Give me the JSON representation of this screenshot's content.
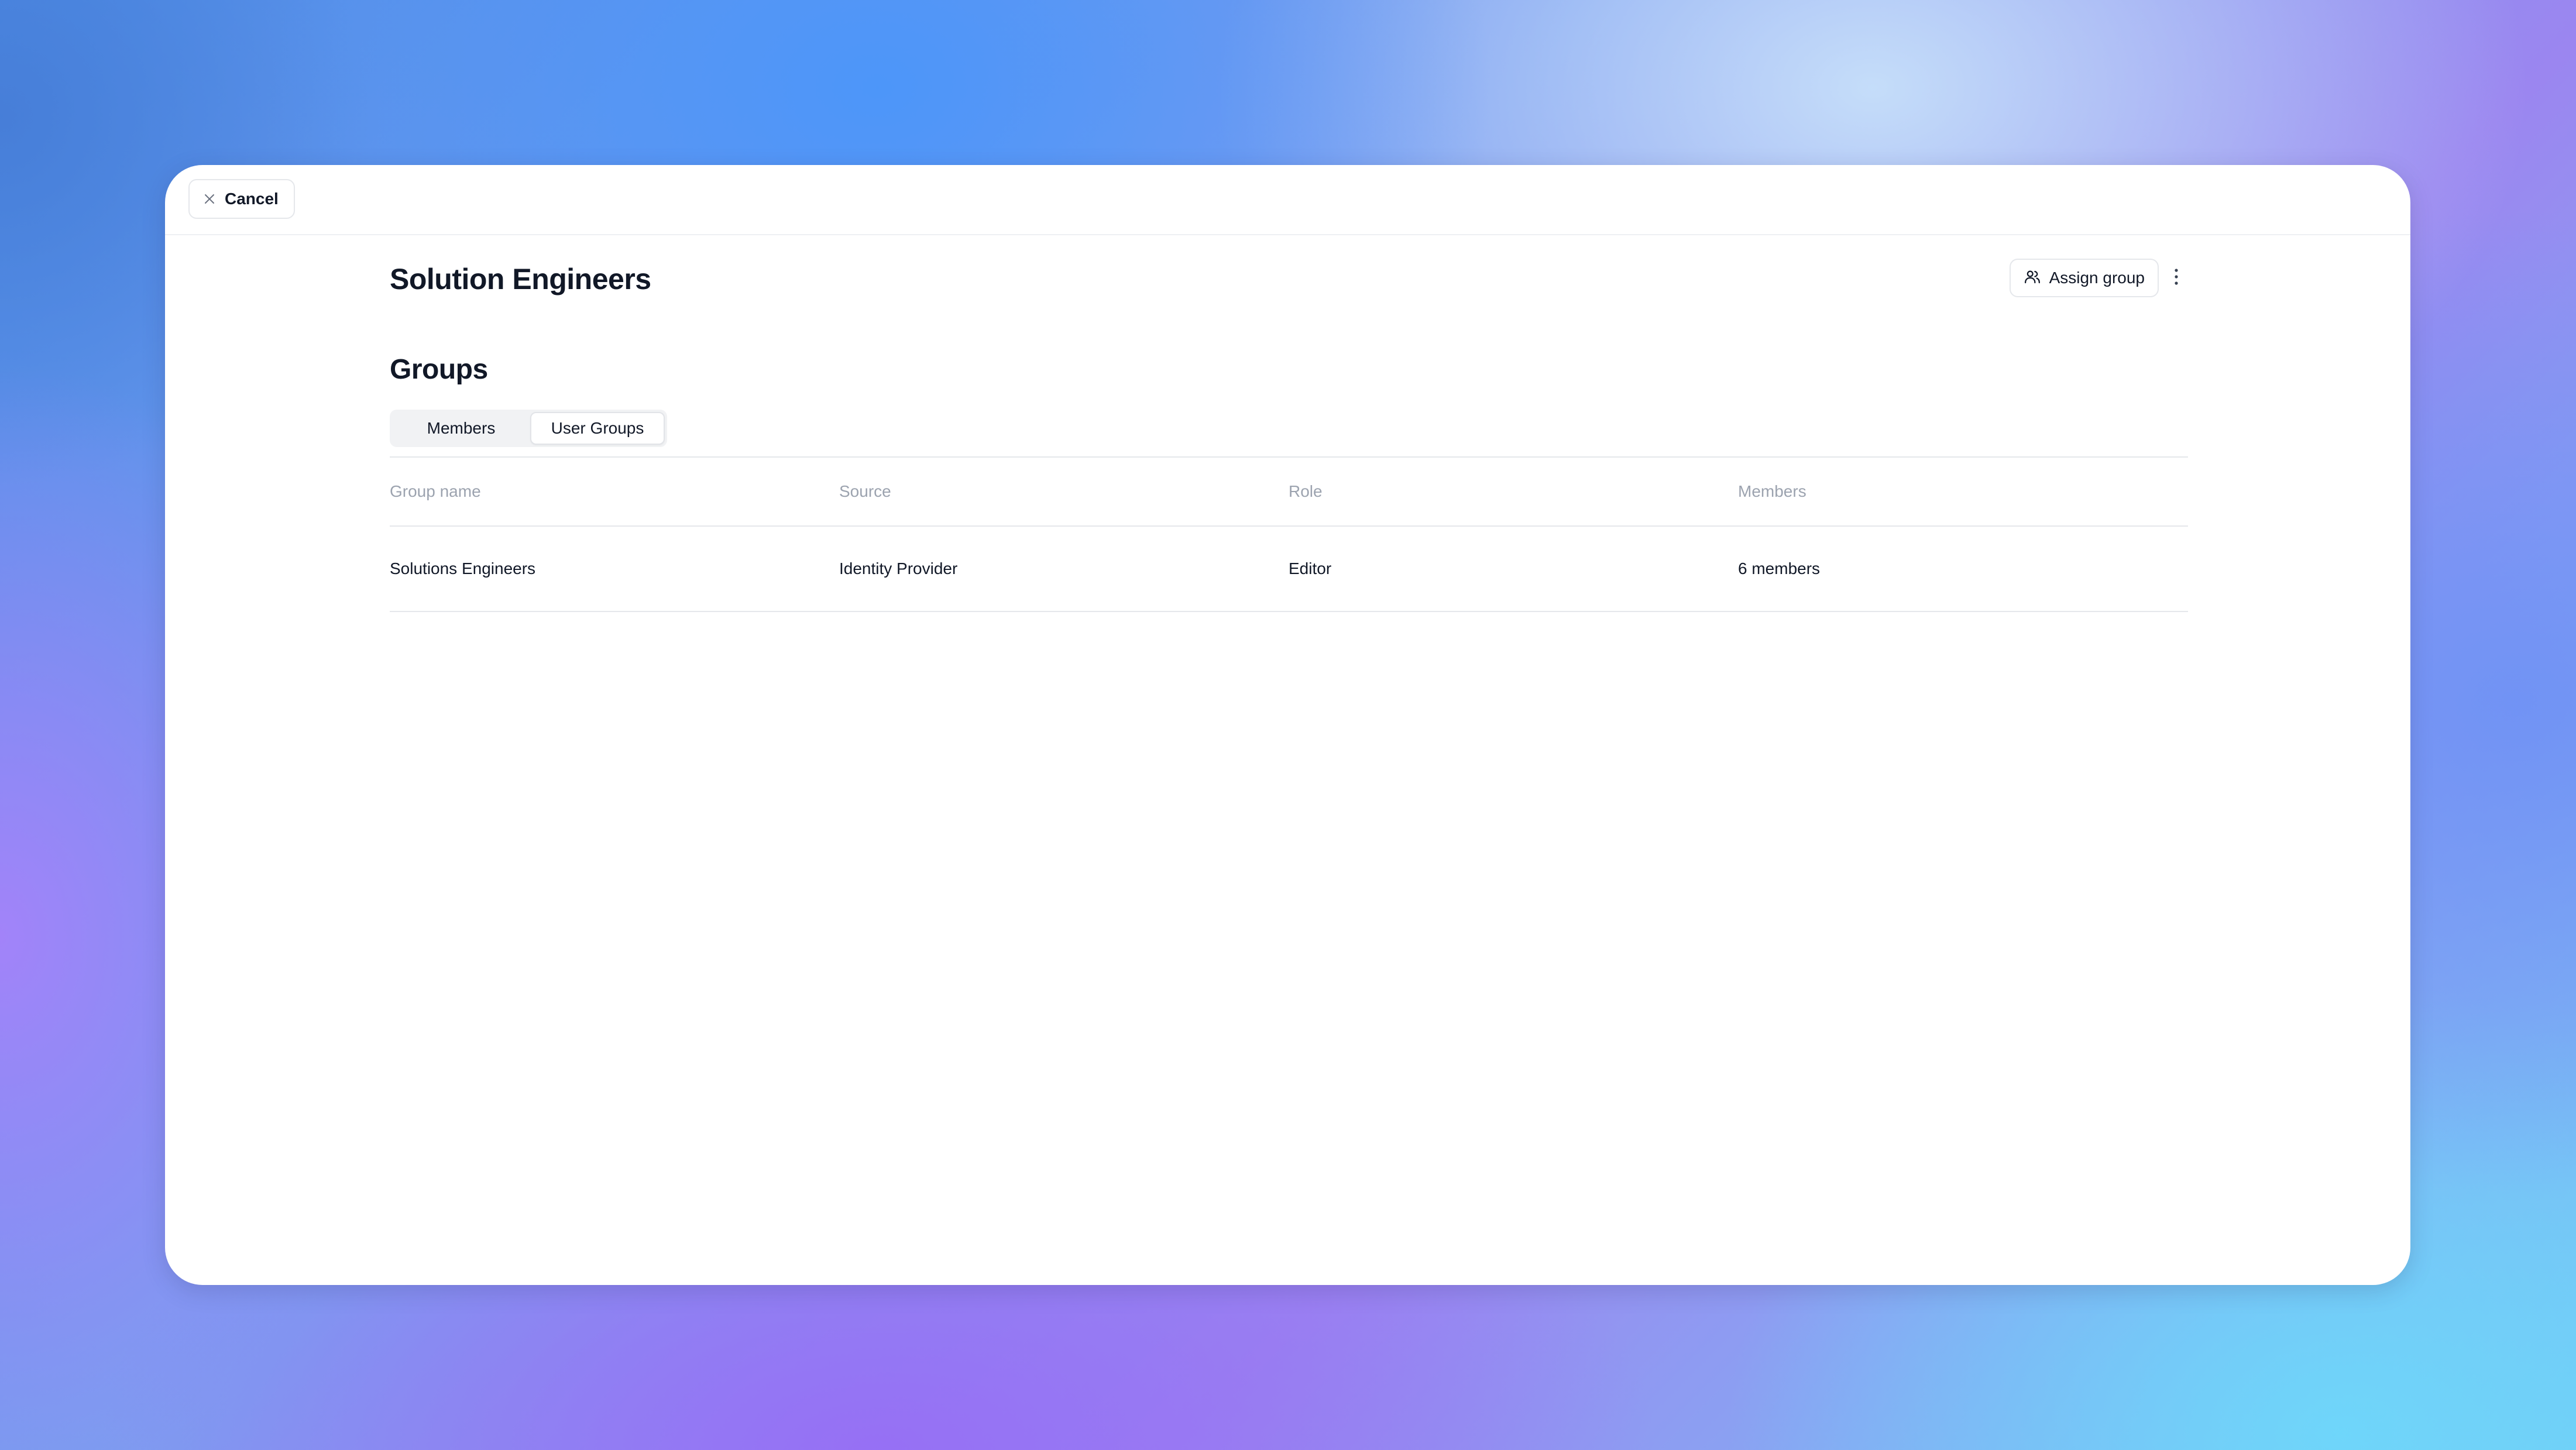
{
  "topbar": {
    "cancel_label": "Cancel",
    "cancel_icon": "x-icon"
  },
  "header": {
    "title": "Solution Engineers",
    "assign_label": "Assign group",
    "assign_icon": "users-icon",
    "more_icon": "vertical-dots-icon"
  },
  "groups": {
    "title": "Groups",
    "tabs": [
      {
        "label": "Members",
        "active": false
      },
      {
        "label": "User Groups",
        "active": true
      }
    ]
  },
  "table": {
    "columns": [
      "Group name",
      "Source",
      "Role",
      "Members"
    ],
    "rows": [
      [
        "Solutions Engineers",
        "Identity Provider",
        "Editor",
        "6 members"
      ]
    ]
  },
  "colors": {
    "text": "#111827",
    "muted": "#9ca3af",
    "border": "#e5e7eb",
    "tab_bg": "#f1f2f4"
  }
}
